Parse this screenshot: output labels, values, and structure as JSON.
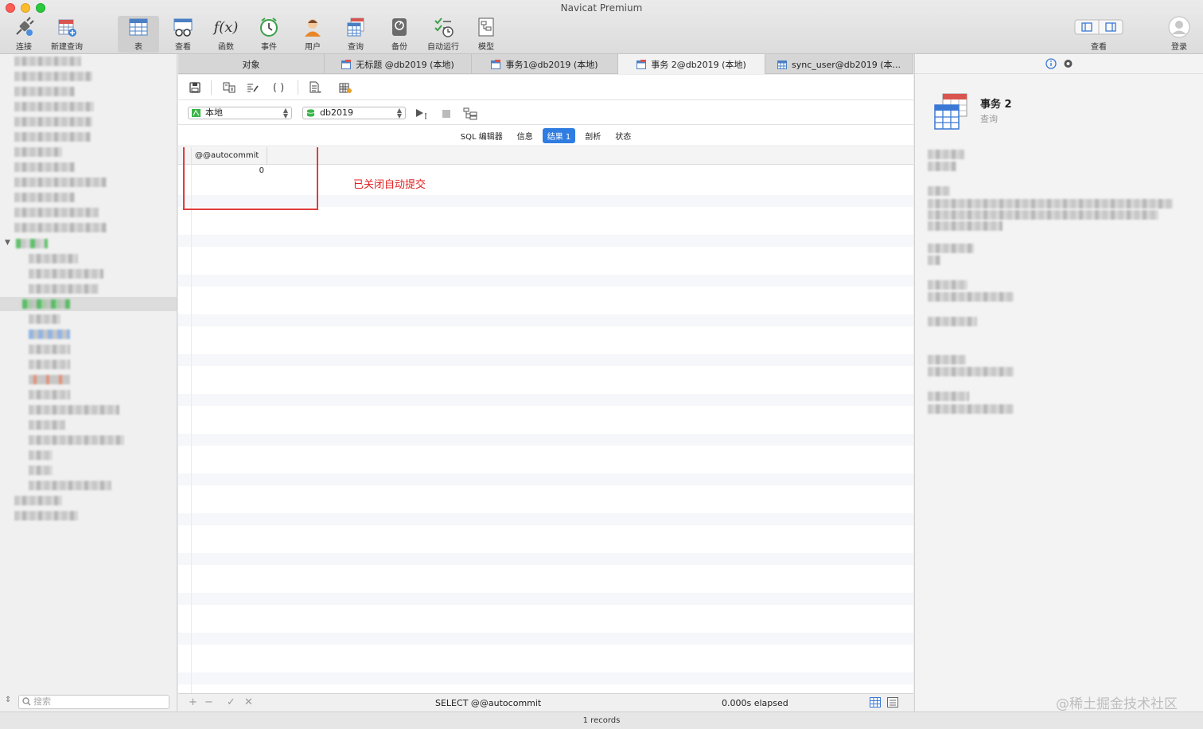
{
  "window": {
    "title": "Navicat Premium"
  },
  "toolbar": {
    "items": [
      {
        "label": "连接"
      },
      {
        "label": "新建查询"
      },
      {
        "label": "表"
      },
      {
        "label": "查看"
      },
      {
        "label": "函数"
      },
      {
        "label": "事件"
      },
      {
        "label": "用户"
      },
      {
        "label": "查询"
      },
      {
        "label": "备份"
      },
      {
        "label": "自动运行"
      },
      {
        "label": "模型"
      }
    ],
    "view_label": "查看",
    "login_label": "登录"
  },
  "tabs": [
    {
      "label": "对象"
    },
    {
      "label": "无标题 @db2019 (本地)"
    },
    {
      "label": "事务1@db2019 (本地)"
    },
    {
      "label": "事务 2@db2019 (本地)"
    },
    {
      "label": "sync_user@db2019 (本..."
    }
  ],
  "query": {
    "connection": "本地",
    "database": "db2019",
    "subtabs": [
      {
        "label": "SQL 编辑器"
      },
      {
        "label": "信息"
      },
      {
        "label": "结果 1"
      },
      {
        "label": "剖析"
      },
      {
        "label": "状态"
      }
    ]
  },
  "result": {
    "columns": [
      "@@autocommit"
    ],
    "rows": [
      [
        "0"
      ]
    ],
    "annotation": "已关闭自动提交"
  },
  "status": {
    "sql": "SELECT  @@autocommit",
    "elapsed": "0.000s elapsed",
    "records": "1 records"
  },
  "sidebar": {
    "search_placeholder": "搜索"
  },
  "info_panel": {
    "title": "事务 2",
    "subtitle": "查询"
  },
  "watermark": "@稀土掘金技术社区",
  "colors": {
    "accent": "#2f7de1",
    "annotation": "#e02020"
  }
}
